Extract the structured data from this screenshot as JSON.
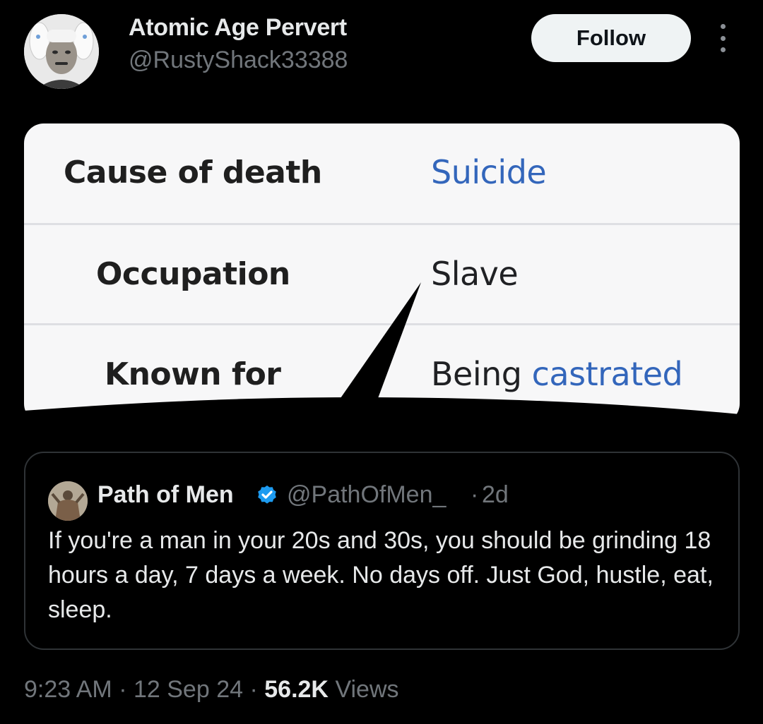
{
  "author": {
    "display_name": "Atomic Age Pervert",
    "handle": "@RustyShack33388",
    "avatar_icon": "profile-avatar-icon"
  },
  "actions": {
    "follow_label": "Follow",
    "more_icon": "more-horizontal-icon"
  },
  "media": {
    "rows": [
      {
        "label": "Cause of death",
        "value": "Suicide"
      },
      {
        "label": "Occupation",
        "value": "Slave"
      },
      {
        "label": "Known for",
        "value_plain": "Being",
        "value_link": "castrated"
      }
    ],
    "link_color": "#3366bb"
  },
  "quoted_tweet": {
    "display_name": "Path of Men",
    "handle": "@PathOfMen_",
    "separator": "·",
    "time": "2d",
    "verified_icon": "verified-badge-icon",
    "verified_color": "#1d9bf0",
    "text": "If you're a man in your 20s and 30s, you should be grinding 18 hours a day, 7 days a week. No days off. Just God, hustle, eat, sleep."
  },
  "footer": {
    "time": "9:23 AM",
    "separator": "·",
    "date": "12 Sep 24",
    "views_count": "56.2K",
    "views_label": "Views"
  }
}
